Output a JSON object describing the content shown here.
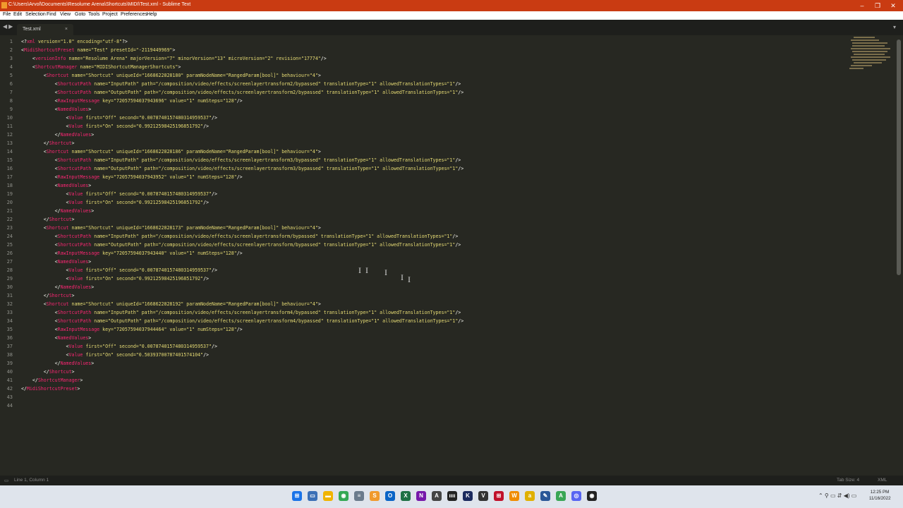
{
  "window": {
    "title": "C:\\Users\\Arvol\\Documents\\Resolume Arena\\Shortcuts\\MIDI\\Test.xml - Sublime Text",
    "minimize_glyph": "–",
    "maximize_glyph": "❐",
    "close_glyph": "✕"
  },
  "menu": [
    "File",
    "Edit",
    "Selection",
    "Find",
    "View",
    "Goto",
    "Tools",
    "Project",
    "Preferences",
    "Help"
  ],
  "tabs": [
    {
      "label": "Test.xml",
      "close": "×"
    }
  ],
  "nav_arrows": "◀▶",
  "tab_dropdown": "▾",
  "line_numbers": [
    "1",
    "2",
    "3",
    "4",
    "5",
    "6",
    "7",
    "8",
    "9",
    "10",
    "11",
    "12",
    "13",
    "14",
    "15",
    "16",
    "17",
    "18",
    "19",
    "20",
    "21",
    "22",
    "23",
    "24",
    "25",
    "26",
    "27",
    "28",
    "29",
    "30",
    "31",
    "32",
    "33",
    "34",
    "35",
    "36",
    "37",
    "38",
    "39",
    "40",
    "41",
    "42",
    "43",
    "44"
  ],
  "code_lines": [
    [
      {
        "c": "p",
        "t": "<?"
      },
      {
        "c": "t",
        "t": "xml"
      },
      {
        "c": "a",
        "t": " version=\"1.0\" encoding=\"utf-8\""
      },
      {
        "c": "p",
        "t": "?>"
      }
    ],
    [
      {
        "c": "p",
        "t": "<"
      },
      {
        "c": "t",
        "t": "MidiShortcutPreset"
      },
      {
        "c": "a",
        "t": " name=\"Test\" presetId=\"-2119449969\""
      },
      {
        "c": "p",
        "t": ">"
      }
    ],
    [
      {
        "c": "p",
        "t": "    <"
      },
      {
        "c": "t",
        "t": "versionInfo"
      },
      {
        "c": "a",
        "t": " name=\"Resolume Arena\" majorVersion=\"7\" minorVersion=\"13\" microVersion=\"2\" revision=\"17774\""
      },
      {
        "c": "p",
        "t": "/>"
      }
    ],
    [
      {
        "c": "p",
        "t": "    <"
      },
      {
        "c": "t",
        "t": "ShortcutManager"
      },
      {
        "c": "a",
        "t": " name=\"MIDIShortcutManagerShortcuts\""
      },
      {
        "c": "p",
        "t": ">"
      }
    ],
    [
      {
        "c": "p",
        "t": "        <"
      },
      {
        "c": "t",
        "t": "Shortcut"
      },
      {
        "c": "a",
        "t": " name=\"Shortcut\" uniqueId=\"1668622828180\" paramNodeName=\"RangedParam[bool]\" behaviour=\"4\""
      },
      {
        "c": "p",
        "t": ">"
      }
    ],
    [
      {
        "c": "p",
        "t": "            <"
      },
      {
        "c": "t",
        "t": "ShortcutPath"
      },
      {
        "c": "a",
        "t": " name=\"InputPath\" path=\"/composition/video/effects/screenlayertransform2/bypassed\" translationType=\"1\" allowedTranslationTypes=\"1\""
      },
      {
        "c": "p",
        "t": "/>"
      }
    ],
    [
      {
        "c": "p",
        "t": "            <"
      },
      {
        "c": "t",
        "t": "ShortcutPath"
      },
      {
        "c": "a",
        "t": " name=\"OutputPath\" path=\"/composition/video/effects/screenlayertransform2/bypassed\" translationType=\"1\" allowedTranslationTypes=\"1\""
      },
      {
        "c": "p",
        "t": "/>"
      }
    ],
    [
      {
        "c": "p",
        "t": "            <"
      },
      {
        "c": "t",
        "t": "RawInputMessage"
      },
      {
        "c": "a",
        "t": " key=\"72057594037943696\" value=\"1\" numSteps=\"128\""
      },
      {
        "c": "p",
        "t": "/>"
      }
    ],
    [
      {
        "c": "p",
        "t": "            <"
      },
      {
        "c": "t",
        "t": "NamedValues"
      },
      {
        "c": "p",
        "t": ">"
      }
    ],
    [
      {
        "c": "p",
        "t": "                <"
      },
      {
        "c": "t",
        "t": "Value"
      },
      {
        "c": "a",
        "t": " first=\"Off\" second=\"0.0078740157480314959537\""
      },
      {
        "c": "p",
        "t": "/>"
      }
    ],
    [
      {
        "c": "p",
        "t": "                <"
      },
      {
        "c": "t",
        "t": "Value"
      },
      {
        "c": "a",
        "t": " first=\"On\" second=\"0.99212598425196851792\""
      },
      {
        "c": "p",
        "t": "/>"
      }
    ],
    [
      {
        "c": "p",
        "t": "            </"
      },
      {
        "c": "t",
        "t": "NamedValues"
      },
      {
        "c": "p",
        "t": ">"
      }
    ],
    [
      {
        "c": "p",
        "t": "        </"
      },
      {
        "c": "t",
        "t": "Shortcut"
      },
      {
        "c": "p",
        "t": ">"
      }
    ],
    [
      {
        "c": "p",
        "t": "        <"
      },
      {
        "c": "t",
        "t": "Shortcut"
      },
      {
        "c": "a",
        "t": " name=\"Shortcut\" uniqueId=\"1668622828186\" paramNodeName=\"RangedParam[bool]\" behaviour=\"4\""
      },
      {
        "c": "p",
        "t": ">"
      }
    ],
    [
      {
        "c": "p",
        "t": "            <"
      },
      {
        "c": "t",
        "t": "ShortcutPath"
      },
      {
        "c": "a",
        "t": " name=\"InputPath\" path=\"/composition/video/effects/screenlayertransform3/bypassed\" translationType=\"1\" allowedTranslationTypes=\"1\""
      },
      {
        "c": "p",
        "t": "/>"
      }
    ],
    [
      {
        "c": "p",
        "t": "            <"
      },
      {
        "c": "t",
        "t": "ShortcutPath"
      },
      {
        "c": "a",
        "t": " name=\"OutputPath\" path=\"/composition/video/effects/screenlayertransform3/bypassed\" translationType=\"1\" allowedTranslationTypes=\"1\""
      },
      {
        "c": "p",
        "t": "/>"
      }
    ],
    [
      {
        "c": "p",
        "t": "            <"
      },
      {
        "c": "t",
        "t": "RawInputMessage"
      },
      {
        "c": "a",
        "t": " key=\"72057594037943952\" value=\"1\" numSteps=\"128\""
      },
      {
        "c": "p",
        "t": "/>"
      }
    ],
    [
      {
        "c": "p",
        "t": "            <"
      },
      {
        "c": "t",
        "t": "NamedValues"
      },
      {
        "c": "p",
        "t": ">"
      }
    ],
    [
      {
        "c": "p",
        "t": "                <"
      },
      {
        "c": "t",
        "t": "Value"
      },
      {
        "c": "a",
        "t": " first=\"Off\" second=\"0.0078740157480314959537\""
      },
      {
        "c": "p",
        "t": "/>"
      }
    ],
    [
      {
        "c": "p",
        "t": "                <"
      },
      {
        "c": "t",
        "t": "Value"
      },
      {
        "c": "a",
        "t": " first=\"On\" second=\"0.99212598425196851792\""
      },
      {
        "c": "p",
        "t": "/>"
      }
    ],
    [
      {
        "c": "p",
        "t": "            </"
      },
      {
        "c": "t",
        "t": "NamedValues"
      },
      {
        "c": "p",
        "t": ">"
      }
    ],
    [
      {
        "c": "p",
        "t": "        </"
      },
      {
        "c": "t",
        "t": "Shortcut"
      },
      {
        "c": "p",
        "t": ">"
      }
    ],
    [
      {
        "c": "p",
        "t": "        <"
      },
      {
        "c": "t",
        "t": "Shortcut"
      },
      {
        "c": "a",
        "t": " name=\"Shortcut\" uniqueId=\"1668622828173\" paramNodeName=\"RangedParam[bool]\" behaviour=\"4\""
      },
      {
        "c": "p",
        "t": ">"
      }
    ],
    [
      {
        "c": "p",
        "t": "            <"
      },
      {
        "c": "t",
        "t": "ShortcutPath"
      },
      {
        "c": "a",
        "t": " name=\"InputPath\" path=\"/composition/video/effects/screenlayertransform/bypassed\" translationType=\"1\" allowedTranslationTypes=\"1\""
      },
      {
        "c": "p",
        "t": "/>"
      }
    ],
    [
      {
        "c": "p",
        "t": "            <"
      },
      {
        "c": "t",
        "t": "ShortcutPath"
      },
      {
        "c": "a",
        "t": " name=\"OutputPath\" path=\"/composition/video/effects/screenlayertransform/bypassed\" translationType=\"1\" allowedTranslationTypes=\"1\""
      },
      {
        "c": "p",
        "t": "/>"
      }
    ],
    [
      {
        "c": "p",
        "t": "            <"
      },
      {
        "c": "t",
        "t": "RawInputMessage"
      },
      {
        "c": "a",
        "t": " key=\"72057594037943440\" value=\"1\" numSteps=\"128\""
      },
      {
        "c": "p",
        "t": "/>"
      }
    ],
    [
      {
        "c": "p",
        "t": "            <"
      },
      {
        "c": "t",
        "t": "NamedValues"
      },
      {
        "c": "p",
        "t": ">"
      }
    ],
    [
      {
        "c": "p",
        "t": "                <"
      },
      {
        "c": "t",
        "t": "Value"
      },
      {
        "c": "a",
        "t": " first=\"Off\" second=\"0.0078740157480314959537\""
      },
      {
        "c": "p",
        "t": "/>"
      }
    ],
    [
      {
        "c": "p",
        "t": "                <"
      },
      {
        "c": "t",
        "t": "Value"
      },
      {
        "c": "a",
        "t": " first=\"On\" second=\"0.99212598425196851792\""
      },
      {
        "c": "p",
        "t": "/>"
      }
    ],
    [
      {
        "c": "p",
        "t": "            </"
      },
      {
        "c": "t",
        "t": "NamedValues"
      },
      {
        "c": "p",
        "t": ">"
      }
    ],
    [
      {
        "c": "p",
        "t": "        </"
      },
      {
        "c": "t",
        "t": "Shortcut"
      },
      {
        "c": "p",
        "t": ">"
      }
    ],
    [
      {
        "c": "p",
        "t": "        <"
      },
      {
        "c": "t",
        "t": "Shortcut"
      },
      {
        "c": "a",
        "t": " name=\"Shortcut\" uniqueId=\"1668622828192\" paramNodeName=\"RangedParam[bool]\" behaviour=\"4\""
      },
      {
        "c": "p",
        "t": ">"
      }
    ],
    [
      {
        "c": "p",
        "t": "            <"
      },
      {
        "c": "t",
        "t": "ShortcutPath"
      },
      {
        "c": "a",
        "t": " name=\"InputPath\" path=\"/composition/video/effects/screenlayertransform4/bypassed\" translationType=\"1\" allowedTranslationTypes=\"1\""
      },
      {
        "c": "p",
        "t": "/>"
      }
    ],
    [
      {
        "c": "p",
        "t": "            <"
      },
      {
        "c": "t",
        "t": "ShortcutPath"
      },
      {
        "c": "a",
        "t": " name=\"OutputPath\" path=\"/composition/video/effects/screenlayertransform4/bypassed\" translationType=\"1\" allowedTranslationTypes=\"1\""
      },
      {
        "c": "p",
        "t": "/>"
      }
    ],
    [
      {
        "c": "p",
        "t": "            <"
      },
      {
        "c": "t",
        "t": "RawInputMessage"
      },
      {
        "c": "a",
        "t": " key=\"72057594037944464\" value=\"1\" numSteps=\"128\""
      },
      {
        "c": "p",
        "t": "/>"
      }
    ],
    [
      {
        "c": "p",
        "t": "            <"
      },
      {
        "c": "t",
        "t": "NamedValues"
      },
      {
        "c": "p",
        "t": ">"
      }
    ],
    [
      {
        "c": "p",
        "t": "                <"
      },
      {
        "c": "t",
        "t": "Value"
      },
      {
        "c": "a",
        "t": " first=\"Off\" second=\"0.0078740157480314959537\""
      },
      {
        "c": "p",
        "t": "/>"
      }
    ],
    [
      {
        "c": "p",
        "t": "                <"
      },
      {
        "c": "t",
        "t": "Value"
      },
      {
        "c": "a",
        "t": " first=\"On\" second=\"0.50393700787401574104\""
      },
      {
        "c": "p",
        "t": "/>"
      }
    ],
    [
      {
        "c": "p",
        "t": "            </"
      },
      {
        "c": "t",
        "t": "NamedValues"
      },
      {
        "c": "p",
        "t": ">"
      }
    ],
    [
      {
        "c": "p",
        "t": "        </"
      },
      {
        "c": "t",
        "t": "Shortcut"
      },
      {
        "c": "p",
        "t": ">"
      }
    ],
    [
      {
        "c": "p",
        "t": "    </"
      },
      {
        "c": "t",
        "t": "ShortcutManager"
      },
      {
        "c": "p",
        "t": ">"
      }
    ],
    [
      {
        "c": "p",
        "t": "</"
      },
      {
        "c": "t",
        "t": "MidiShortcutPreset"
      },
      {
        "c": "p",
        "t": ">"
      }
    ],
    [],
    []
  ],
  "cursor_glyph": "I",
  "status": {
    "position": "Line 1, Column 1",
    "tab_size": "Tab Size: 4",
    "syntax": "XML"
  },
  "taskbar": {
    "icons": [
      {
        "name": "windows-start-icon",
        "glyph": "⊞",
        "color": "#1a73e8"
      },
      {
        "name": "task-view-icon",
        "glyph": "▭",
        "color": "#3b6fb6"
      },
      {
        "name": "file-explorer-icon",
        "glyph": "▬",
        "color": "#f0b400"
      },
      {
        "name": "chrome-icon",
        "glyph": "◉",
        "color": "#34a853"
      },
      {
        "name": "notepad-icon",
        "glyph": "≡",
        "color": "#6b7b8c"
      },
      {
        "name": "sublime-text-icon",
        "glyph": "S",
        "color": "#f09a2d"
      },
      {
        "name": "outlook-icon",
        "glyph": "O",
        "color": "#0a64c6"
      },
      {
        "name": "excel-icon",
        "glyph": "X",
        "color": "#1e7145"
      },
      {
        "name": "onenote-icon",
        "glyph": "N",
        "color": "#7719aa"
      },
      {
        "name": "app-icon",
        "glyph": "A",
        "color": "#444444"
      },
      {
        "name": "app-icon",
        "glyph": "ıııı",
        "color": "#222222"
      },
      {
        "name": "k-app-icon",
        "glyph": "K",
        "color": "#1b2a5e"
      },
      {
        "name": "v-app-icon",
        "glyph": "V",
        "color": "#333333"
      },
      {
        "name": "app-icon",
        "glyph": "⊞",
        "color": "#c0102a"
      },
      {
        "name": "app-icon",
        "glyph": "W",
        "color": "#f08c00"
      },
      {
        "name": "a-app-icon",
        "glyph": "a",
        "color": "#e0b000"
      },
      {
        "name": "app-icon",
        "glyph": "✎",
        "color": "#2b5797"
      },
      {
        "name": "app-icon",
        "glyph": "A",
        "color": "#3aa655"
      },
      {
        "name": "discord-icon",
        "glyph": "◎",
        "color": "#5865f2"
      },
      {
        "name": "obs-icon",
        "glyph": "◉",
        "color": "#222222"
      }
    ],
    "tray": "⌃  ⚲  ▭ ⇵ ◀) ▭",
    "time": "12:25 PM",
    "date": "11/16/2022"
  }
}
